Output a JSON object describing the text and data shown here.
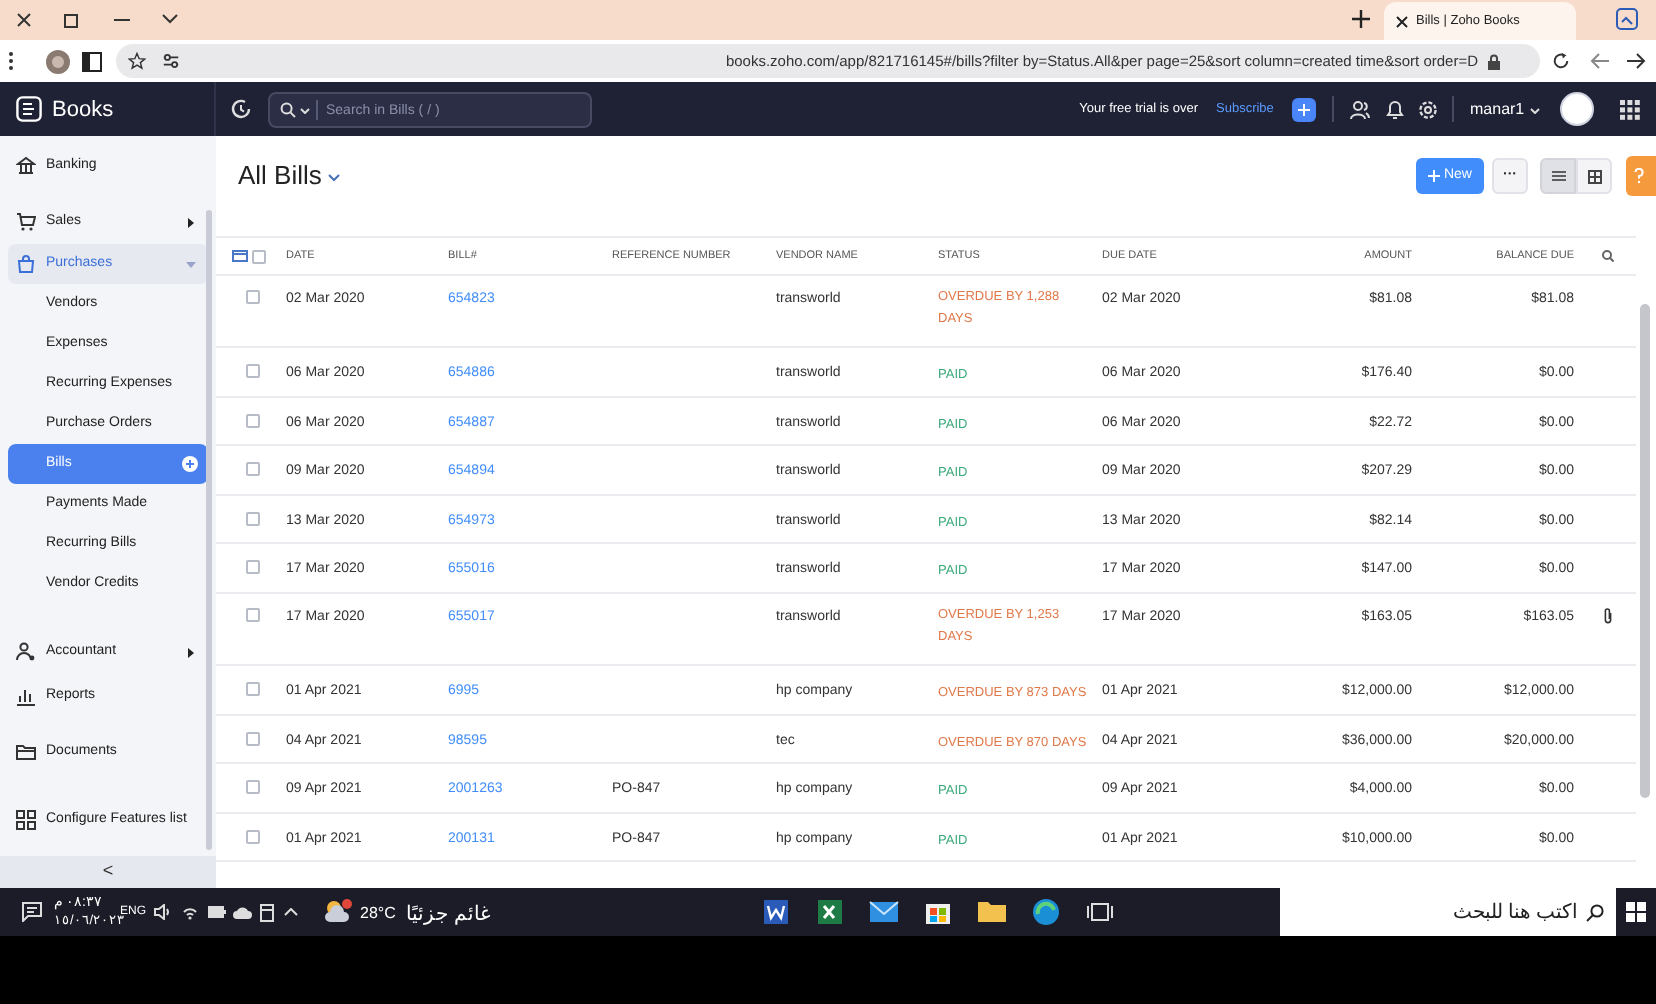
{
  "browser": {
    "tab_title": "Bills | Zoho Books",
    "url": "books.zoho.com/app/821716145#/bills?filter by=Status.All&per page=25&sort column=created time&sort order=D"
  },
  "app_header": {
    "brand": "Books",
    "search_placeholder": "Search in Bills ( / )",
    "trial_text": "Your free trial is over",
    "subscribe": "Subscribe",
    "user": "manar1"
  },
  "sidebar": {
    "items": [
      {
        "label": "Banking"
      },
      {
        "label": "Sales",
        "expanded": false
      },
      {
        "label": "Purchases",
        "expanded": true,
        "children": [
          {
            "label": "Vendors",
            "selected": false
          },
          {
            "label": "Expenses",
            "selected": false
          },
          {
            "label": "Recurring Expenses",
            "selected": false
          },
          {
            "label": "Purchase Orders",
            "selected": false
          },
          {
            "label": "Bills",
            "selected": true
          },
          {
            "label": "Payments Made",
            "selected": false
          },
          {
            "label": "Recurring Bills",
            "selected": false
          },
          {
            "label": "Vendor Credits",
            "selected": false
          }
        ]
      },
      {
        "label": "Accountant",
        "expanded": false
      },
      {
        "label": "Reports"
      },
      {
        "label": "Documents"
      },
      {
        "label": "Configure Features list"
      }
    ],
    "collapse": "<"
  },
  "page": {
    "title": "All Bills",
    "new_button": "New",
    "more_button": "···"
  },
  "table": {
    "select_all_checked": false,
    "columns": [
      "DATE",
      "BILL#",
      "REFERENCE NUMBER",
      "VENDOR NAME",
      "STATUS",
      "DUE DATE",
      "AMOUNT",
      "BALANCE DUE"
    ],
    "rows": [
      {
        "date": "02 Mar 2020",
        "bill": "654823",
        "reference": "",
        "vendor": "transworld",
        "status": "OVERDUE BY 1,288 DAYS",
        "kind": "overdue",
        "due_date": "02 Mar 2020",
        "amount": "$81.08",
        "balance_due": "$81.08",
        "attachment": false,
        "checked": false
      },
      {
        "date": "06 Mar 2020",
        "bill": "654886",
        "reference": "",
        "vendor": "transworld",
        "status": "PAID",
        "kind": "paid",
        "due_date": "06 Mar 2020",
        "amount": "$176.40",
        "balance_due": "$0.00",
        "attachment": false,
        "checked": false
      },
      {
        "date": "06 Mar 2020",
        "bill": "654887",
        "reference": "",
        "vendor": "transworld",
        "status": "PAID",
        "kind": "paid",
        "due_date": "06 Mar 2020",
        "amount": "$22.72",
        "balance_due": "$0.00",
        "attachment": false,
        "checked": false
      },
      {
        "date": "09 Mar 2020",
        "bill": "654894",
        "reference": "",
        "vendor": "transworld",
        "status": "PAID",
        "kind": "paid",
        "due_date": "09 Mar 2020",
        "amount": "$207.29",
        "balance_due": "$0.00",
        "attachment": false,
        "checked": false
      },
      {
        "date": "13 Mar 2020",
        "bill": "654973",
        "reference": "",
        "vendor": "transworld",
        "status": "PAID",
        "kind": "paid",
        "due_date": "13 Mar 2020",
        "amount": "$82.14",
        "balance_due": "$0.00",
        "attachment": false,
        "checked": false
      },
      {
        "date": "17 Mar 2020",
        "bill": "655016",
        "reference": "",
        "vendor": "transworld",
        "status": "PAID",
        "kind": "paid",
        "due_date": "17 Mar 2020",
        "amount": "$147.00",
        "balance_due": "$0.00",
        "attachment": false,
        "checked": false
      },
      {
        "date": "17 Mar 2020",
        "bill": "655017",
        "reference": "",
        "vendor": "transworld",
        "status": "OVERDUE BY 1,253 DAYS",
        "kind": "overdue",
        "due_date": "17 Mar 2020",
        "amount": "$163.05",
        "balance_due": "$163.05",
        "attachment": true,
        "checked": false
      },
      {
        "date": "01 Apr 2021",
        "bill": "6995",
        "reference": "",
        "vendor": "hp company",
        "status": "OVERDUE BY 873 DAYS",
        "kind": "overdue",
        "due_date": "01 Apr 2021",
        "amount": "$12,000.00",
        "balance_due": "$12,000.00",
        "attachment": false,
        "checked": false
      },
      {
        "date": "04 Apr 2021",
        "bill": "98595",
        "reference": "",
        "vendor": "tec",
        "status": "OVERDUE BY 870 DAYS",
        "kind": "overdue",
        "due_date": "04 Apr 2021",
        "amount": "$36,000.00",
        "balance_due": "$20,000.00",
        "attachment": false,
        "checked": false
      },
      {
        "date": "09 Apr 2021",
        "bill": "2001263",
        "reference": "PO-847",
        "vendor": "hp company",
        "status": "PAID",
        "kind": "paid",
        "due_date": "09 Apr 2021",
        "amount": "$4,000.00",
        "balance_due": "$0.00",
        "attachment": false,
        "checked": false
      },
      {
        "date": "01 Apr 2021",
        "bill": "200131",
        "reference": "PO-847",
        "vendor": "hp company",
        "status": "PAID",
        "kind": "paid",
        "due_date": "01 Apr 2021",
        "amount": "$10,000.00",
        "balance_due": "$0.00",
        "attachment": false,
        "checked": false
      }
    ]
  },
  "taskbar": {
    "search_placeholder": "اكتب هنا للبحث",
    "weather_temp": "28°C",
    "weather_text": "غائم جزئيًا",
    "language": "ENG",
    "time": "٠٨:٣٧ م",
    "date": "١٥/٠٦/٢٠٢٣"
  }
}
